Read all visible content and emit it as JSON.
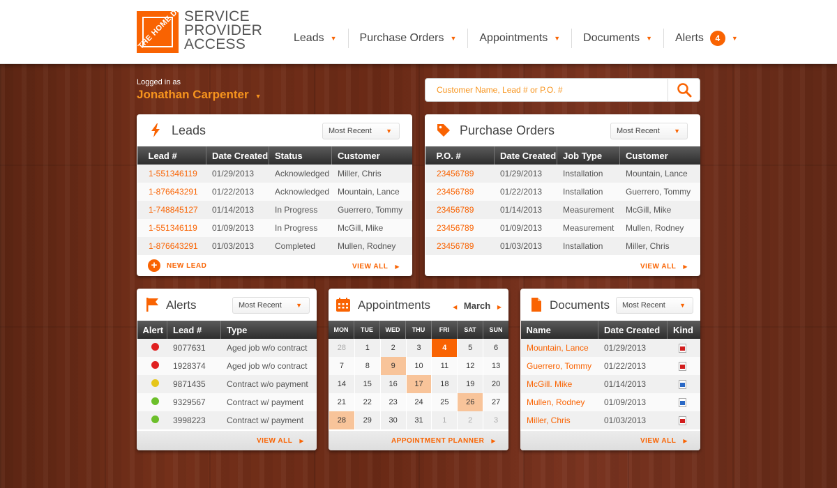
{
  "brand": {
    "lines": [
      "SERVICE",
      "PROVIDER",
      "ACCESS"
    ],
    "logo_text": "THE HOME DEPOT"
  },
  "nav": [
    {
      "label": "Leads"
    },
    {
      "label": "Purchase Orders"
    },
    {
      "label": "Appointments"
    },
    {
      "label": "Documents"
    },
    {
      "label": "Alerts",
      "badge": "4"
    }
  ],
  "user": {
    "logged_label": "Logged in as",
    "name": "Jonathan Carpenter"
  },
  "search": {
    "placeholder": "Customer Name, Lead # or P.O. #"
  },
  "leads": {
    "title": "Leads",
    "filter": "Most Recent",
    "columns": [
      "Lead #",
      "Date Created",
      "Status",
      "Customer"
    ],
    "rows": [
      [
        "1-551346119",
        "01/29/2013",
        "Acknowledged",
        "Miller, Chris"
      ],
      [
        "1-876643291",
        "01/22/2013",
        "Acknowledged",
        "Mountain, Lance"
      ],
      [
        "1-748845127",
        "01/14/2013",
        "In Progress",
        "Guerrero, Tommy"
      ],
      [
        "1-551346119",
        "01/09/2013",
        "In Progress",
        "McGill, Mike"
      ],
      [
        "1-876643291",
        "01/03/2013",
        "Completed",
        "Mullen, Rodney"
      ]
    ],
    "new_label": "NEW LEAD",
    "view_all": "VIEW ALL"
  },
  "purchase_orders": {
    "title": "Purchase Orders",
    "filter": "Most Recent",
    "columns": [
      "P.O. #",
      "Date Created",
      "Job Type",
      "Customer"
    ],
    "rows": [
      [
        "23456789",
        "01/29/2013",
        "Installation",
        "Mountain, Lance"
      ],
      [
        "23456789",
        "01/22/2013",
        "Installation",
        "Guerrero, Tommy"
      ],
      [
        "23456789",
        "01/14/2013",
        "Measurement",
        "McGill, Mike"
      ],
      [
        "23456789",
        "01/09/2013",
        "Measurement",
        "Mullen, Rodney"
      ],
      [
        "23456789",
        "01/03/2013",
        "Installation",
        "Miller, Chris"
      ]
    ],
    "view_all": "VIEW ALL"
  },
  "alerts": {
    "title": "Alerts",
    "filter": "Most Recent",
    "columns": [
      "Alert",
      "Lead #",
      "Type"
    ],
    "rows": [
      {
        "color": "#e02020",
        "lead": "9077631",
        "type": "Aged job w/o contract"
      },
      {
        "color": "#e02020",
        "lead": "1928374",
        "type": "Aged job w/o contract"
      },
      {
        "color": "#e6c619",
        "lead": "9871435",
        "type": "Contract w/o payment"
      },
      {
        "color": "#6cbf2a",
        "lead": "9329567",
        "type": "Contract w/ payment"
      },
      {
        "color": "#6cbf2a",
        "lead": "3998223",
        "type": "Contract w/ payment"
      }
    ],
    "view_all": "VIEW ALL"
  },
  "appointments": {
    "title": "Appointments",
    "month": "March",
    "weekdays": [
      "MON",
      "TUE",
      "WED",
      "THU",
      "FRI",
      "SAT",
      "SUN"
    ],
    "weeks": [
      [
        "28",
        "1",
        "2",
        "3",
        "4",
        "5",
        "6"
      ],
      [
        "7",
        "8",
        "9",
        "10",
        "11",
        "12",
        "13"
      ],
      [
        "14",
        "15",
        "16",
        "17",
        "18",
        "19",
        "20"
      ],
      [
        "21",
        "22",
        "23",
        "24",
        "25",
        "26",
        "27"
      ],
      [
        "28",
        "29",
        "30",
        "31",
        "1",
        "2",
        "3"
      ]
    ],
    "planner_label": "APPOINTMENT PLANNER"
  },
  "documents": {
    "title": "Documents",
    "filter": "Most Recent",
    "columns": [
      "Name",
      "Date Created",
      "Kind"
    ],
    "rows": [
      {
        "name": "Mountain, Lance",
        "date": "01/29/2013",
        "kind": "pdf-icon"
      },
      {
        "name": "Guerrero, Tommy",
        "date": "01/22/2013",
        "kind": "pdf-icon"
      },
      {
        "name": "McGill. Mike",
        "date": "01/14/2013",
        "kind": "word-icon"
      },
      {
        "name": "Mullen, Rodney",
        "date": "01/09/2013",
        "kind": "word-icon"
      },
      {
        "name": "Miller, Chris",
        "date": "01/03/2013",
        "kind": "pdf-icon"
      }
    ],
    "view_all": "VIEW ALL"
  },
  "colors": {
    "accent": "#f96302",
    "accent_light": "#f7941d",
    "appt_highlight": "#f8c49a"
  }
}
